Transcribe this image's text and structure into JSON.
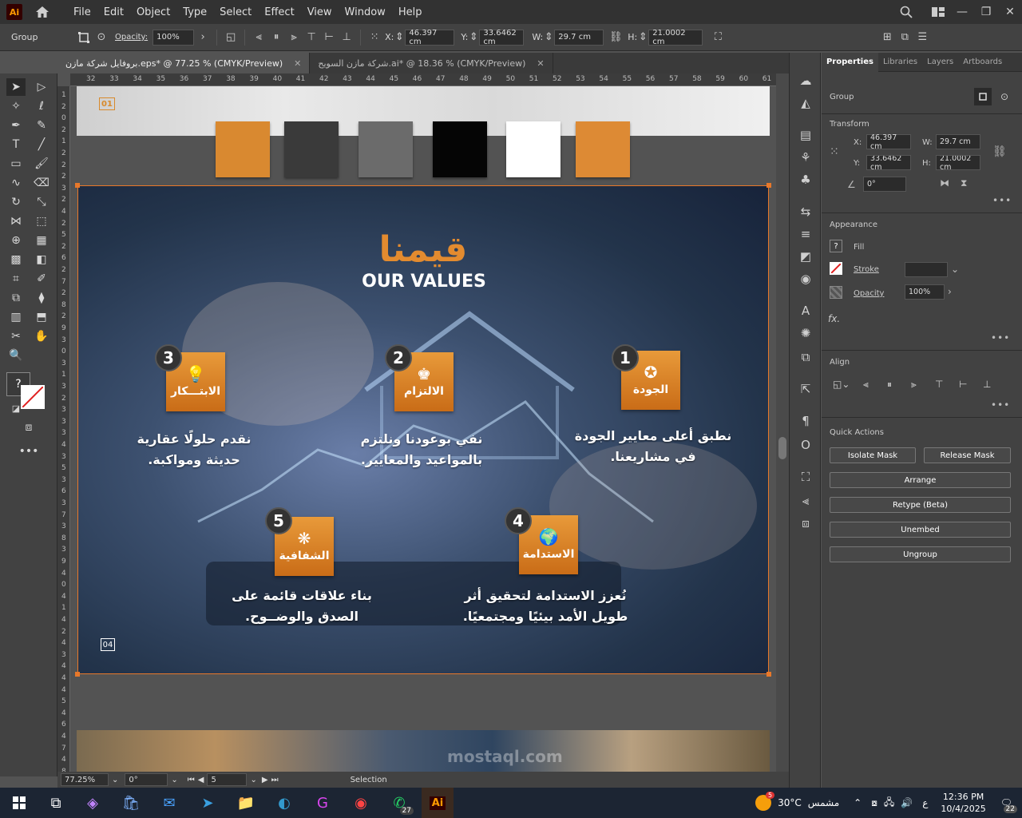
{
  "app": {
    "logo": "Ai",
    "menu": [
      "File",
      "Edit",
      "Object",
      "Type",
      "Select",
      "Effect",
      "View",
      "Window",
      "Help"
    ]
  },
  "control_bar": {
    "selection_label": "Group",
    "opacity_label": "Opacity:",
    "opacity_value": "100%",
    "x_label": "X:",
    "x_value": "46.397 cm",
    "y_label": "Y:",
    "y_value": "33.6462 cm",
    "w_label": "W:",
    "w_value": "29.7 cm",
    "h_label": "H:",
    "h_value": "21.0002 cm"
  },
  "tabs": [
    {
      "label": "بروفايل شركة مازن.eps* @ 77.25 % (CMYK/Preview)",
      "active": true
    },
    {
      "label": "شركة مازن السويح.ai* @ 18.36 % (CMYK/Preview)",
      "active": false
    }
  ],
  "ruler_top": [
    "32",
    "33",
    "34",
    "35",
    "36",
    "37",
    "38",
    "39",
    "40",
    "41",
    "42",
    "43",
    "44",
    "45",
    "46",
    "47",
    "48",
    "49",
    "50",
    "51",
    "52",
    "53",
    "54",
    "55",
    "56",
    "57",
    "58",
    "59",
    "60",
    "61"
  ],
  "ruler_left": [
    "1",
    "2",
    "0",
    "2",
    "1",
    "2",
    "2",
    "2",
    "3",
    "2",
    "4",
    "2",
    "5",
    "2",
    "6",
    "2",
    "7",
    "2",
    "8",
    "2",
    "9",
    "3",
    "0",
    "3",
    "1",
    "3",
    "2",
    "3",
    "3",
    "3",
    "4",
    "3",
    "5",
    "3",
    "6",
    "3",
    "7",
    "3",
    "8",
    "3",
    "9",
    "4",
    "0",
    "4",
    "1",
    "4",
    "2",
    "4",
    "3",
    "4",
    "4",
    "4",
    "5",
    "4",
    "6",
    "4",
    "7",
    "4",
    "8"
  ],
  "document": {
    "top_page_number": "01",
    "swatch_colors": [
      "#d98930",
      "#3a3a3a",
      "#6b6b6b",
      "#050505",
      "#ffffff",
      "#dd8a34"
    ],
    "title_ar": "قيمنا",
    "title_en": "OUR VALUES",
    "values": [
      {
        "num": "1",
        "label": "الجودة",
        "icon": "award-ribbon-icon",
        "desc_line1": "نطبق أعلى معايير الجودة",
        "desc_line2": "في مشاريعنا."
      },
      {
        "num": "2",
        "label": "الالتزام",
        "icon": "person-commitment-icon",
        "desc_line1": "نفي بوعودنا ونلتزم",
        "desc_line2": "بالمواعيد والمعايير."
      },
      {
        "num": "3",
        "label": "الابتـــكار",
        "icon": "lightbulb-icon",
        "desc_line1": "نقدم حلولًا عقارية",
        "desc_line2": "حديثة ومواكبة."
      },
      {
        "num": "4",
        "label": "الاستدامة",
        "icon": "globe-hands-icon",
        "desc_line1": "نُعزز الاستدامة لتحقيق أثر",
        "desc_line2": "طويل الأمد بيئيًا ومجتمعيًا."
      },
      {
        "num": "5",
        "label": "الشفافية",
        "icon": "network-icon",
        "desc_line1": "بناء علاقات قائمة على",
        "desc_line2": "الصدق والوضــوح."
      }
    ],
    "bottom_page_number": "04"
  },
  "status_bar": {
    "zoom": "77.25%",
    "rotation": "0°",
    "artboard": "5",
    "mode": "Selection"
  },
  "properties_panel": {
    "tabs": [
      "Properties",
      "Libraries",
      "Layers",
      "Artboards"
    ],
    "selection": "Group",
    "transform_label": "Transform",
    "x_label": "X:",
    "x_value": "46.397 cm",
    "y_label": "Y:",
    "y_value": "33.6462 cm",
    "w_label": "W:",
    "w_value": "29.7 cm",
    "h_label": "H:",
    "h_value": "21.0002 cm",
    "angle_value": "0°",
    "appearance_label": "Appearance",
    "fill_label": "Fill",
    "stroke_label": "Stroke",
    "opacity_label": "Opacity",
    "opacity_value": "100%",
    "fx_label": "fx.",
    "align_label": "Align",
    "quick_actions_label": "Quick Actions",
    "buttons": {
      "isolate_mask": "Isolate Mask",
      "release_mask": "Release Mask",
      "arrange": "Arrange",
      "retype": "Retype (Beta)",
      "unembed": "Unembed",
      "ungroup": "Ungroup"
    }
  },
  "taskbar": {
    "weather_temp": "30°C",
    "weather_label": "مشمس",
    "weather_badge": "5",
    "lang": "ع",
    "time": "12:36 PM",
    "date": "10/4/2025",
    "notif_count": "22",
    "whatsapp_badge": "27"
  },
  "watermark": "mostaql.com"
}
